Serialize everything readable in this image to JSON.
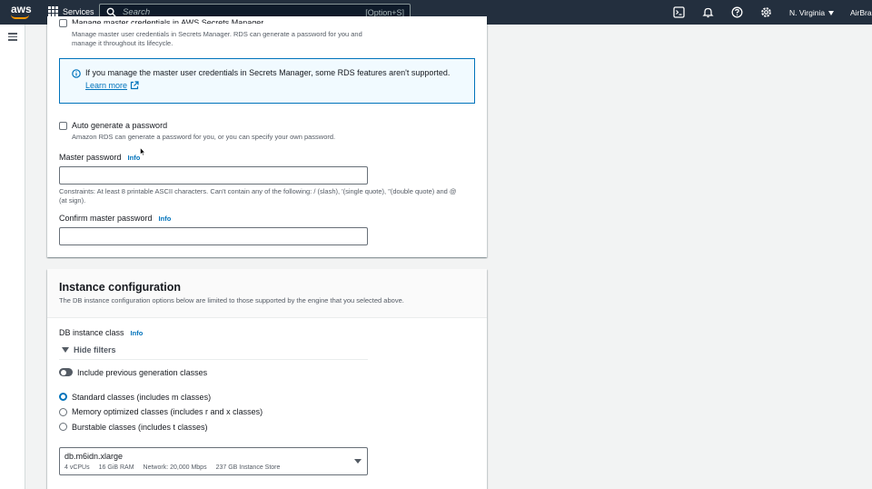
{
  "topnav": {
    "logo_text": "aws",
    "services_label": "Services",
    "search_placeholder": "Search",
    "search_shortcut": "[Option+S]",
    "region": "N. Virginia",
    "account": "AirBrai"
  },
  "credentials": {
    "manage_checkbox_label": "Manage master credentials in AWS Secrets Manager",
    "manage_desc_line1": "Manage master user credentials in Secrets Manager. RDS can generate a password for you and",
    "manage_desc_line2": "manage it throughout its lifecycle.",
    "alert_message": "If you manage the master user credentials in Secrets Manager, some RDS features aren't supported.",
    "alert_link": "Learn more",
    "auto_generate_label": "Auto generate a password",
    "auto_generate_desc": "Amazon RDS can generate a password for you, or you can specify your own password.",
    "master_password_label": "Master password",
    "info": "Info",
    "constraints_line1": "Constraints: At least 8 printable ASCII characters. Can't contain any of the following: / (slash), '(single quote), \"(double quote) and @",
    "constraints_line2": "(at sign).",
    "confirm_password_label": "Confirm master password"
  },
  "instance_config": {
    "title": "Instance configuration",
    "description": "The DB instance configuration options below are limited to those supported by the engine that you selected above.",
    "db_class_label": "DB instance class",
    "info": "Info",
    "hide_filters": "Hide filters",
    "include_previous_label": "Include previous generation classes",
    "classes": [
      {
        "label": "Standard classes (includes m classes)",
        "checked": true
      },
      {
        "label": "Memory optimized classes (includes r and x classes)",
        "checked": false
      },
      {
        "label": "Burstable classes (includes t classes)",
        "checked": false
      }
    ],
    "selected_class": "db.m6idn.xlarge",
    "selected_tags": [
      "4 vCPUs",
      "16 GiB RAM",
      "Network: 20,000 Mbps",
      "237 GB Instance Store"
    ]
  },
  "colors": {
    "nav_bg": "#232f3e",
    "accent": "#0073bb",
    "brand_orange": "#ff9900",
    "page_bg": "#f2f3f3"
  }
}
